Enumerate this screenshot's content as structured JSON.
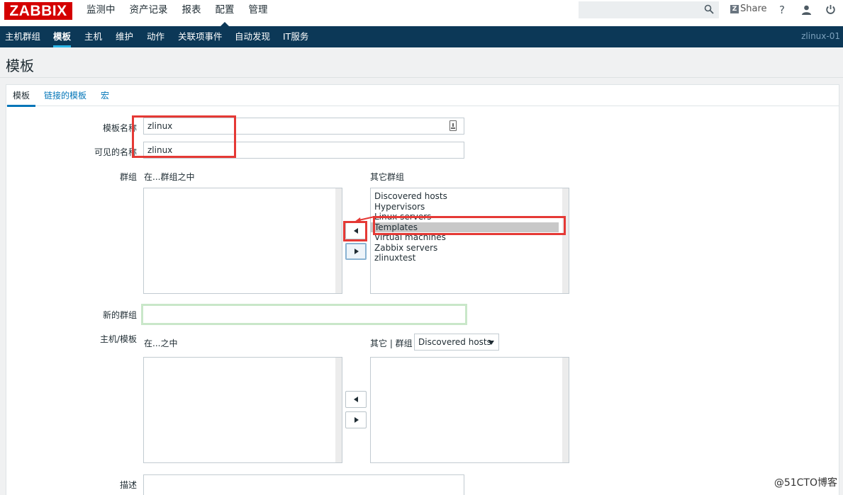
{
  "logo": "ZABBIX",
  "top_menu": [
    {
      "label": "监测中"
    },
    {
      "label": "资产记录"
    },
    {
      "label": "报表"
    },
    {
      "label": "配置"
    },
    {
      "label": "管理"
    }
  ],
  "top_right": {
    "search_value": "",
    "share_label": "Share",
    "help_icon": "?",
    "user_icon": "user-icon",
    "logout_icon": "power-icon"
  },
  "nav": {
    "items": [
      {
        "label": "主机群组"
      },
      {
        "label": "模板"
      },
      {
        "label": "主机"
      },
      {
        "label": "维护"
      },
      {
        "label": "动作"
      },
      {
        "label": "关联项事件"
      },
      {
        "label": "自动发现"
      },
      {
        "label": "IT服务"
      }
    ],
    "host_label": "zlinux-01"
  },
  "page": {
    "title": "模板"
  },
  "tabs": [
    {
      "label": "模板"
    },
    {
      "label": "链接的模板"
    },
    {
      "label": "宏"
    }
  ],
  "form": {
    "template_name_label": "模板名称",
    "template_name_value": "zlinux",
    "visible_name_label": "可见的名称",
    "visible_name_value": "zlinux",
    "groups_label": "群组",
    "in_groups_label": "在...群组之中",
    "other_groups_label": "其它群组",
    "other_groups": [
      "Discovered hosts",
      "Hypervisors",
      "Linux servers",
      "Templates",
      "Virtual machines",
      "Zabbix servers",
      "zlinuxtest"
    ],
    "other_groups_selected": "Templates",
    "new_group_label": "新的群组",
    "new_group_value": "",
    "hosts_templates_label": "主机/模板",
    "in_label": "在...之中",
    "other_group_label": "其它 | 群组",
    "group_select_value": "Discovered hosts",
    "description_label": "描述"
  },
  "watermark": "@51CTO博客",
  "colors": {
    "nav_bg": "#0c3857",
    "logo_red": "#d40000",
    "link_blue": "#0275b8",
    "annotation_red": "#e53935"
  }
}
